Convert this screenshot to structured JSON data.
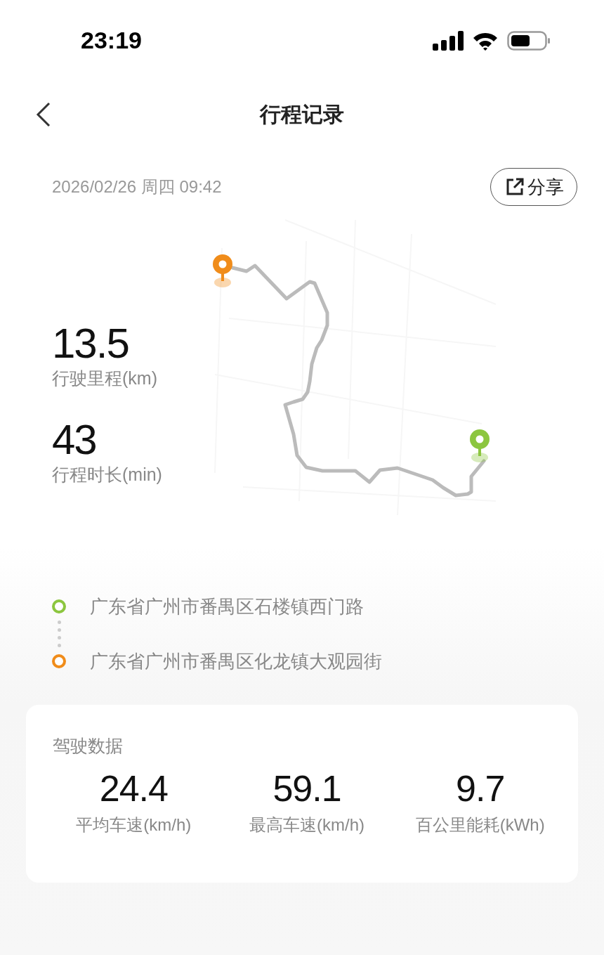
{
  "status_bar": {
    "time": "23:19"
  },
  "header": {
    "title": "行程记录"
  },
  "trip": {
    "datetime": "2026/02/26 周四 09:42",
    "share_label": "分享"
  },
  "stats": [
    {
      "value": "13.5",
      "label": "行驶里程(km)"
    },
    {
      "value": "43",
      "label": "行程时长(min)"
    }
  ],
  "route": [
    {
      "kind": "start",
      "address": "广东省广州市番禺区石楼镇西门路",
      "color": "#8cc63f"
    },
    {
      "kind": "end",
      "address": "广东省广州市番禺区化龙镇大观园街",
      "color": "#f08c1a"
    }
  ],
  "driving_data": {
    "title": "驾驶数据",
    "metrics": [
      {
        "value": "24.4",
        "label": "平均车速(km/h)"
      },
      {
        "value": "59.1",
        "label": "最高车速(km/h)"
      },
      {
        "value": "9.7",
        "label": "百公里能耗(kWh)"
      }
    ]
  }
}
